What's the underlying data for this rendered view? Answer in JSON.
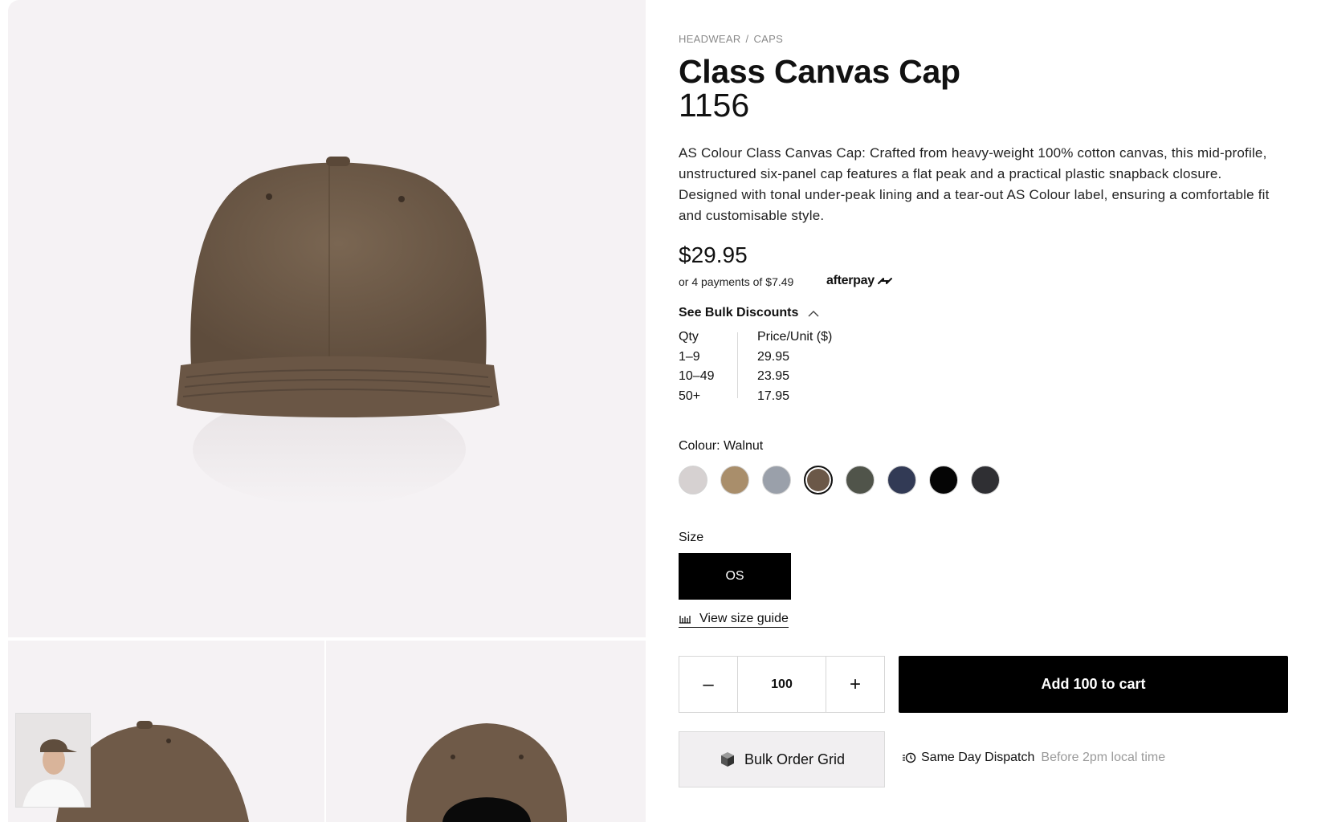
{
  "breadcrumb": {
    "category": "HEADWEAR",
    "separator": "/",
    "subcategory": "CAPS"
  },
  "product": {
    "title": "Class Canvas Cap",
    "style_code": "1156",
    "description": "AS Colour Class Canvas Cap: Crafted from heavy-weight 100% cotton canvas, this mid-profile, unstructured six-panel cap features a flat peak and a practical plastic snapback closure. Designed with tonal under-peak lining and a tear-out AS Colour label, ensuring a comfortable fit and customisable style.",
    "price": "$29.95",
    "installments_prefix": "or 4 payments of",
    "installments_amount": "$7.49",
    "afterpay_label": "afterpay"
  },
  "bulk": {
    "toggle_label": "See Bulk Discounts",
    "qty_header": "Qty",
    "price_header": "Price/Unit ($)",
    "rows": [
      {
        "qty": "1–9",
        "price": "29.95"
      },
      {
        "qty": "10–49",
        "price": "23.95"
      },
      {
        "qty": "50+",
        "price": "17.95"
      }
    ]
  },
  "colour": {
    "label": "Colour: Walnut",
    "swatches": [
      {
        "name": "natural",
        "hex": "#d6d1d1"
      },
      {
        "name": "tan",
        "hex": "#a98e6b"
      },
      {
        "name": "grey",
        "hex": "#9aa0aa"
      },
      {
        "name": "walnut",
        "hex": "#6b5848",
        "selected": true
      },
      {
        "name": "army",
        "hex": "#50544a"
      },
      {
        "name": "navy",
        "hex": "#323a55"
      },
      {
        "name": "black",
        "hex": "#050505"
      },
      {
        "name": "coal",
        "hex": "#2f2f33"
      }
    ]
  },
  "size": {
    "label": "Size",
    "selected": "OS",
    "guide_label": "View size guide"
  },
  "cart": {
    "minus": "–",
    "plus": "+",
    "quantity": "100",
    "add_label": "Add 100 to cart",
    "bulk_grid_label": "Bulk Order Grid"
  },
  "dispatch": {
    "label": "Same Day Dispatch",
    "detail": "Before 2pm local time"
  },
  "colors": {
    "page_bg": "#ffffff",
    "gallery_bg": "#f5f2f4",
    "accent": "#000000",
    "muted_text": "#8a8a8a"
  },
  "icons": {
    "collapse": "chevron-up-icon",
    "size_guide": "ruler-icon",
    "bulk_grid": "box-icon",
    "dispatch": "clock-icon",
    "afterpay": "afterpay-logo-icon"
  }
}
